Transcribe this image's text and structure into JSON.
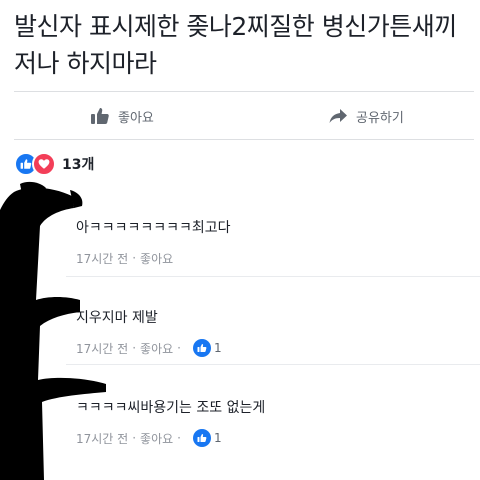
{
  "post": {
    "text": "발신자 표시제한 좆나2찌질한 병신가튼새끼 저나 하지마라"
  },
  "actions": {
    "like_label": "좋아요",
    "share_label": "공유하기"
  },
  "reactions": {
    "icons": [
      "like-icon",
      "heart-icon"
    ],
    "count": "13개"
  },
  "comments": [
    {
      "text": "아ㅋㅋㅋㅋㅋㅋㅋㅋ최고다",
      "time": "17시간 전",
      "sep": "·",
      "like_label": "좋아요",
      "like_count": null
    },
    {
      "text": "지우지마 제발",
      "time": "17시간 전",
      "sep": "·",
      "like_label": "좋아요",
      "sep2": "·",
      "like_count": "1"
    },
    {
      "text": "ㅋㅋㅋㅋ씨바용기는 조또 없는게",
      "time": "17시간 전",
      "sep": "·",
      "like_label": "좋아요",
      "sep2": "·",
      "like_count": "1"
    }
  ],
  "colors": {
    "text_primary": "#1d2129",
    "text_secondary": "#90949c",
    "action_gray": "#606770",
    "like_blue": "#1877f2",
    "heart_red": "#f33e58",
    "redaction": "#000000"
  }
}
